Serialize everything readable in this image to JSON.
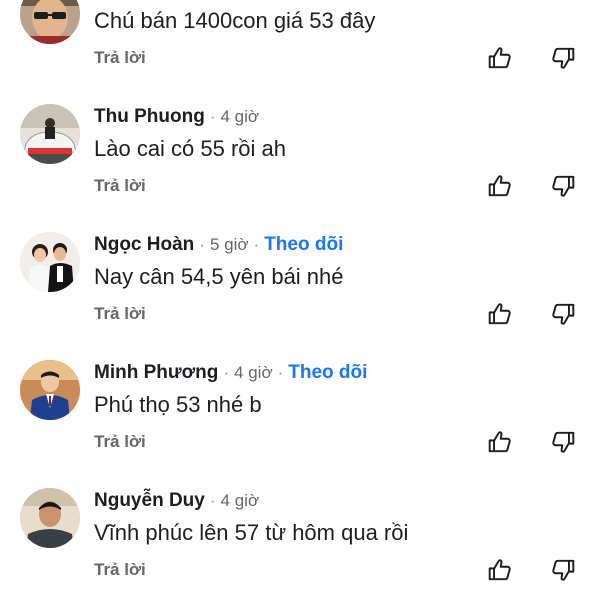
{
  "comments": [
    {
      "name": "",
      "time": "",
      "follow": "",
      "text": "Chú bán 1400con giá 53 đây",
      "reply": "Trả lời",
      "avatar_icon": "person-with-sunglasses"
    },
    {
      "name": "Thu Phuong",
      "time": "4 giờ",
      "follow": "",
      "text": "Lào cai có 55 rồi ah",
      "reply": "Trả lời",
      "avatar_icon": "person-on-car"
    },
    {
      "name": "Ngọc Hoàn",
      "time": "5 giờ",
      "follow": "Theo dõi",
      "text": "Nay cân 54,5 yên bái nhé",
      "reply": "Trả lời",
      "avatar_icon": "couple-photo"
    },
    {
      "name": "Minh Phương",
      "time": "4 giờ",
      "follow": "Theo dõi",
      "text": "Phú thọ 53 nhé b",
      "reply": "Trả lời",
      "avatar_icon": "man-in-suit"
    },
    {
      "name": "Nguyễn Duy",
      "time": "4 giờ",
      "follow": "",
      "text": "Vĩnh phúc lên 57 từ hôm qua rồi",
      "reply": "Trả lời",
      "avatar_icon": "man-portrait"
    }
  ],
  "separator": "·",
  "icons": {
    "like": "thumbs-up-outline-icon",
    "dislike": "thumbs-down-outline-icon"
  },
  "colors": {
    "follow": "#1877f2",
    "meta": "#65676b",
    "text": "#1c1e21"
  }
}
